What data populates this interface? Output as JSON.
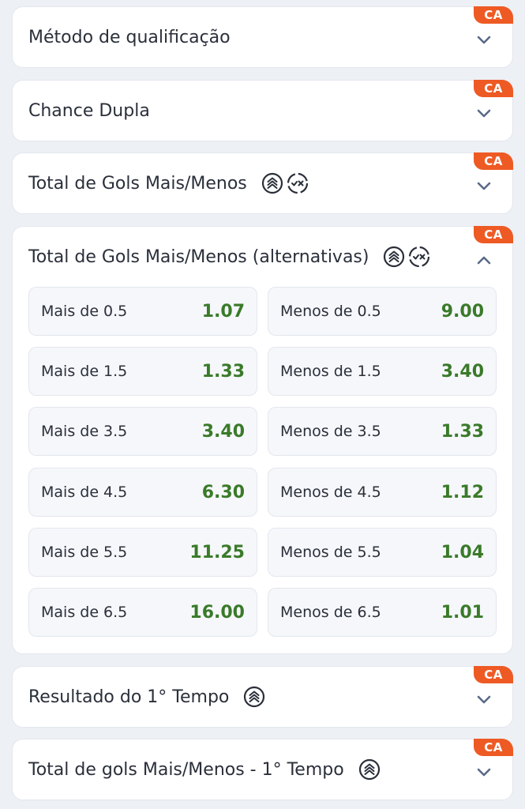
{
  "badge_label": "CA",
  "colors": {
    "badge": "#ee5a24",
    "odds_value": "#3a7a2a",
    "background": "#edf0f5"
  },
  "markets": [
    {
      "title": "Método de qualificação",
      "expanded": false,
      "icons": []
    },
    {
      "title": "Chance Dupla",
      "expanded": false,
      "icons": []
    },
    {
      "title": "Total de Gols Mais/Menos",
      "expanded": false,
      "icons": [
        "boost-chevrons-icon",
        "swap-check-x-icon"
      ]
    },
    {
      "title": "Total de Gols Mais/Menos (alternativas)",
      "expanded": true,
      "icons": [
        "boost-chevrons-icon",
        "swap-check-x-icon"
      ],
      "odds": [
        {
          "over_label": "Mais de 0.5",
          "over_value": "1.07",
          "under_label": "Menos de 0.5",
          "under_value": "9.00"
        },
        {
          "over_label": "Mais de 1.5",
          "over_value": "1.33",
          "under_label": "Menos de 1.5",
          "under_value": "3.40"
        },
        {
          "over_label": "Mais de 3.5",
          "over_value": "3.40",
          "under_label": "Menos de 3.5",
          "under_value": "1.33"
        },
        {
          "over_label": "Mais de 4.5",
          "over_value": "6.30",
          "under_label": "Menos de 4.5",
          "under_value": "1.12"
        },
        {
          "over_label": "Mais de 5.5",
          "over_value": "11.25",
          "under_label": "Menos de 5.5",
          "under_value": "1.04"
        },
        {
          "over_label": "Mais de 6.5",
          "over_value": "16.00",
          "under_label": "Menos de 6.5",
          "under_value": "1.01"
        }
      ]
    },
    {
      "title": "Resultado do 1° Tempo",
      "expanded": false,
      "icons": [
        "boost-chevrons-icon"
      ]
    },
    {
      "title": "Total de gols Mais/Menos - 1° Tempo",
      "expanded": false,
      "icons": [
        "boost-chevrons-icon"
      ]
    }
  ]
}
